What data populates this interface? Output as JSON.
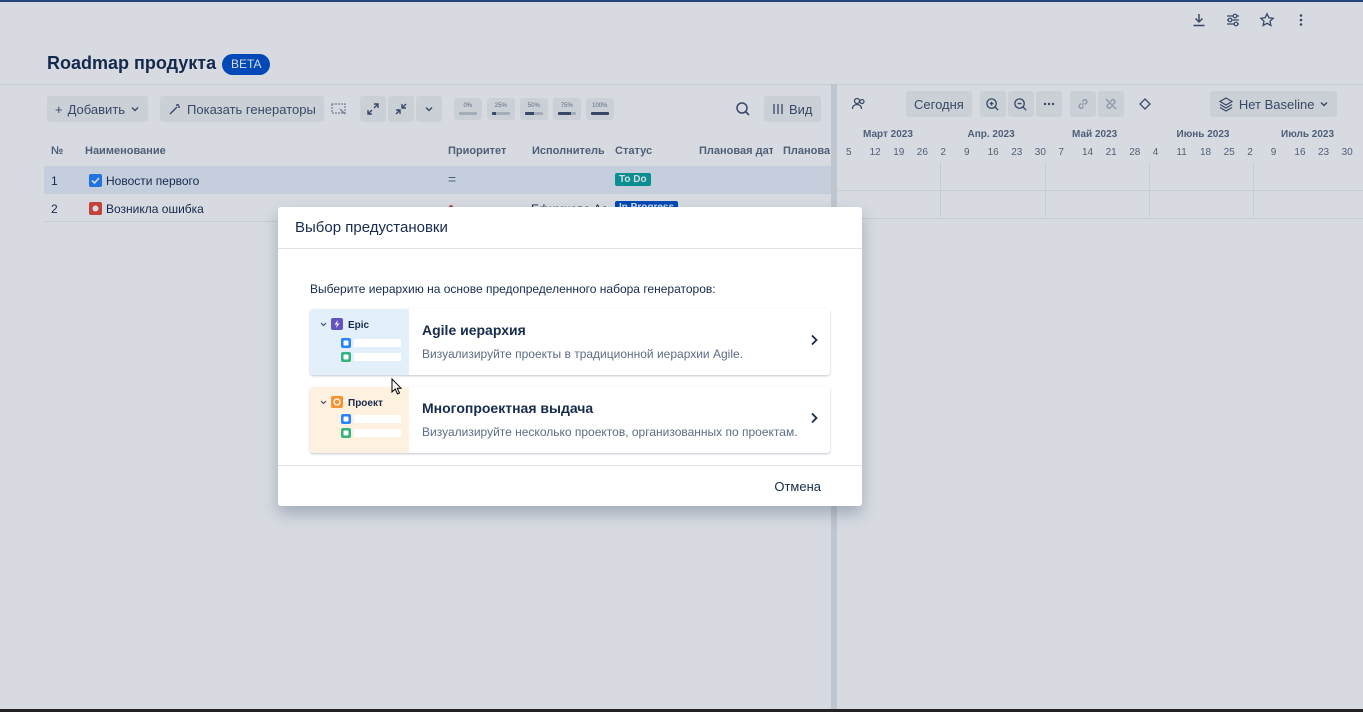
{
  "page": {
    "title": "Roadmap продукта",
    "badge": "BETA"
  },
  "toolbar": {
    "add_label": "Добавить",
    "generators_label": "Показать генераторы",
    "progress": [
      {
        "label": "0%",
        "fill": 0
      },
      {
        "label": "25%",
        "fill": 0.25
      },
      {
        "label": "50%",
        "fill": 0.5
      },
      {
        "label": "75%",
        "fill": 0.75
      },
      {
        "label": "100%",
        "fill": 1
      }
    ],
    "view_label": "Вид"
  },
  "table": {
    "headers": [
      "№",
      "Наименование",
      "Приоритет",
      "Исполнитель",
      "Статус",
      "Плановая дата",
      "Плановая"
    ],
    "rows": [
      {
        "num": "1",
        "name": "Новости первого",
        "priority": "=",
        "assignee": "",
        "status": "To Do",
        "status_color": "#0aa5a0",
        "icon_color": "#2684ff"
      },
      {
        "num": "2",
        "name": "Возникла ошибка",
        "priority": "●",
        "assignee": "Ефимцева Ал",
        "status": "In Progress",
        "status_color": "#0052cc",
        "icon_color": "#e5493a"
      }
    ]
  },
  "gantt": {
    "today_label": "Сегодня",
    "baseline_label": "Нет Baseline",
    "months": [
      "Март 2023",
      "Апр. 2023",
      "Май 2023",
      "Июнь 2023",
      "Июль 2023"
    ],
    "days": [
      "5",
      "12",
      "19",
      "26",
      "2",
      "9",
      "16",
      "23",
      "30",
      "7",
      "14",
      "21",
      "28",
      "4",
      "11",
      "18",
      "25",
      "2",
      "9",
      "16",
      "23",
      "30"
    ]
  },
  "modal": {
    "title": "Выбор предустановки",
    "description": "Выберите иерархию на основе предопределенного набора генераторов:",
    "options": [
      {
        "title": "Agile иерархия",
        "description": "Визуализируйте проекты в традиционной иерархии Agile.",
        "thumb_label": "Epic",
        "thumb_bg": "#e3f0fc",
        "thumb_icon_color": "#6554c0"
      },
      {
        "title": "Многопроектная выдача",
        "description": "Визуализируйте несколько проектов, организованных по проектам.",
        "thumb_label": "Проект",
        "thumb_bg": "#fff1e0",
        "thumb_icon_color": "#f79232"
      }
    ],
    "cancel_label": "Отмена"
  }
}
